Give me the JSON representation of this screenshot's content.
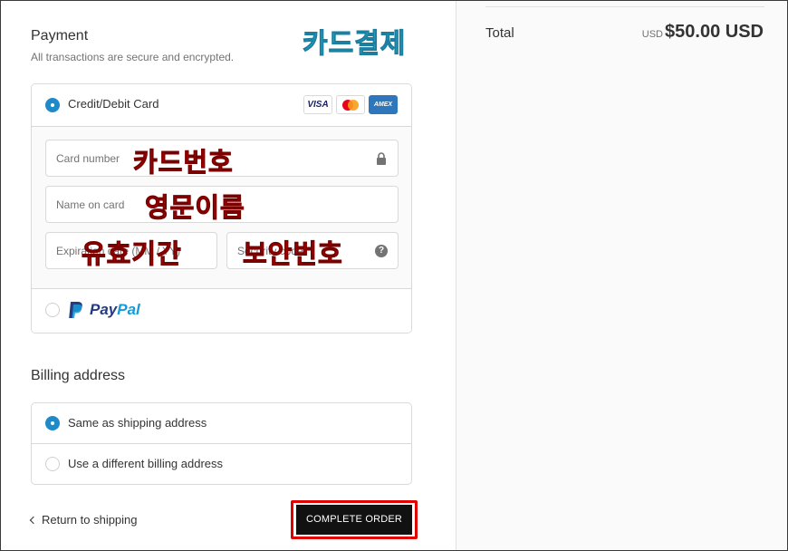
{
  "payment": {
    "title": "Payment",
    "subtitle": "All transactions are secure and encrypted.",
    "annotation": "카드결제"
  },
  "methods": {
    "card": {
      "label": "Credit/Debit Card",
      "selected": true,
      "brands": [
        "VISA",
        "Mastercard",
        "AMEX"
      ],
      "brand_visa_text": "VISA",
      "brand_amex_text": "AMEX"
    },
    "paypal": {
      "label_part1": "Pay",
      "label_part2": "Pal",
      "selected": false
    }
  },
  "fields": {
    "card_number": {
      "placeholder": "Card number",
      "annotation": "카드번호"
    },
    "name_on_card": {
      "placeholder": "Name on card",
      "annotation": "영문이름"
    },
    "expiration": {
      "placeholder": "Expiration date (MM / YY)",
      "annotation": "유효기간"
    },
    "security_code": {
      "placeholder": "Security code",
      "annotation": "보안번호"
    }
  },
  "billing": {
    "title": "Billing address",
    "options": [
      {
        "label": "Same as shipping address",
        "selected": true
      },
      {
        "label": "Use a different billing address",
        "selected": false
      }
    ]
  },
  "footer": {
    "return_link": "Return to shipping",
    "complete_button": "COMPLETE ORDER"
  },
  "summary": {
    "total_label": "Total",
    "currency": "USD",
    "amount": "$50.00 USD"
  },
  "colors": {
    "accent": "#1f8ac9",
    "annotation_red": "#e00000",
    "annotation_blue": "#2cc1e1"
  },
  "icons": [
    "lock-icon",
    "help-icon",
    "chevron-left-icon",
    "paypal-icon"
  ]
}
